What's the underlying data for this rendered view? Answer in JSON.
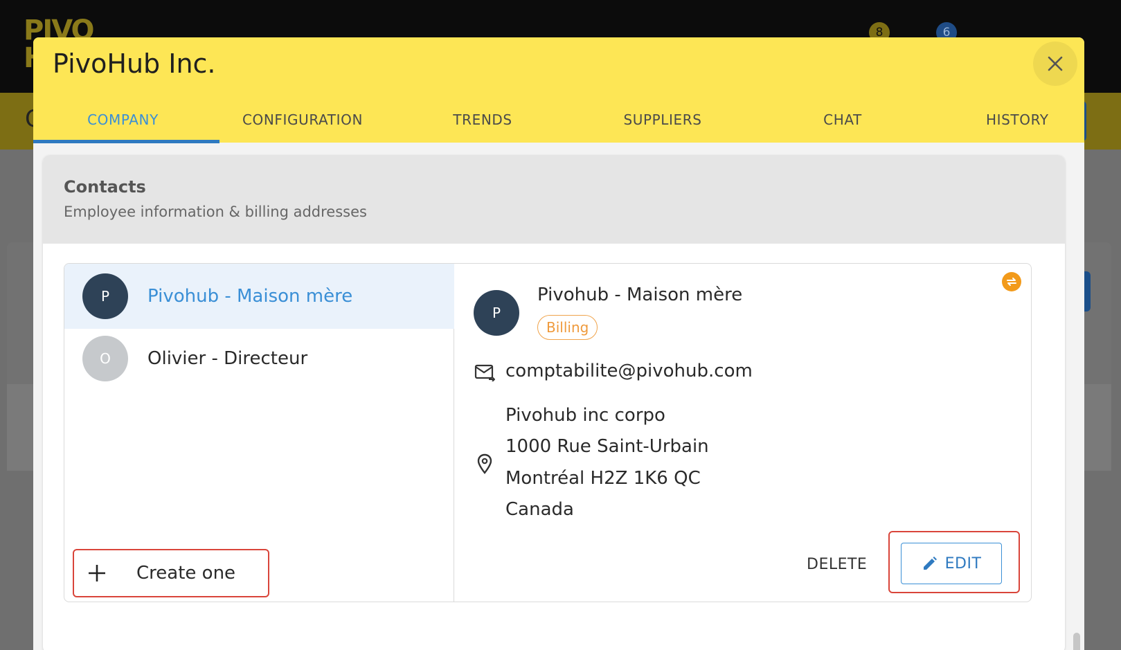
{
  "background": {
    "badge_1": "8",
    "badge_2": "6"
  },
  "dialog": {
    "title": "PivoHub Inc.",
    "tabs": [
      {
        "label": "COMPANY",
        "active": true
      },
      {
        "label": "CONFIGURATION",
        "active": false
      },
      {
        "label": "TRENDS",
        "active": false
      },
      {
        "label": "SUPPLIERS",
        "active": false
      },
      {
        "label": "CHAT",
        "active": false
      },
      {
        "label": "HISTORY",
        "active": false
      }
    ],
    "colors": {
      "header": "#fde655",
      "accent": "#3a8fd6",
      "highlight_border": "#d9453a",
      "badge": "#ef9a3c"
    }
  },
  "contacts": {
    "title": "Contacts",
    "subtitle": "Employee information & billing addresses",
    "list": [
      {
        "initial": "P",
        "name": "Pivohub - Maison mère",
        "selected": true
      },
      {
        "initial": "O",
        "name": "Olivier - Directeur",
        "selected": false
      }
    ],
    "create_label": "Create one",
    "detail": {
      "initial": "P",
      "name": "Pivohub - Maison mère",
      "badge": "Billing",
      "email": "comptabilite@pivohub.com",
      "address": [
        "Pivohub inc corpo",
        "1000 Rue Saint-Urbain",
        "Montréal H2Z 1K6 QC",
        "Canada"
      ],
      "delete_label": "DELETE",
      "edit_label": "EDIT"
    }
  }
}
